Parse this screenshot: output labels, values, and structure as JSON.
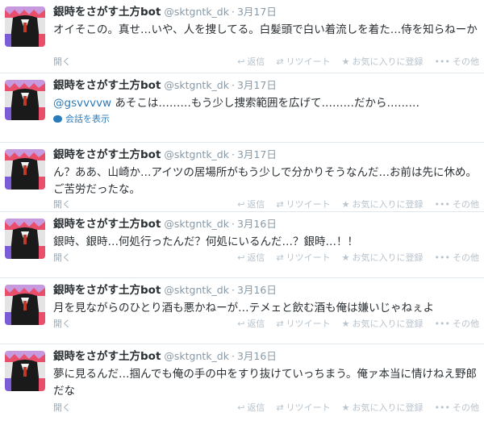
{
  "actions": {
    "reply": "返信",
    "retweet": "リツイート",
    "favorite": "お気に入りに登録",
    "more": "その他"
  },
  "tweets": [
    {
      "name": "銀時をさがす土方bot",
      "handle": "@sktgntk_dk",
      "date": "3月17日",
      "mention": "",
      "text": "オイそこの。真せ…いや、人を捜してる。白髪頭で白い着流しを着た…侍を知らねーか",
      "expand": "開く"
    },
    {
      "name": "銀時をさがす土方bot",
      "handle": "@sktgntk_dk",
      "date": "3月17日",
      "mention": "@gsvvvvw",
      "text": " あそこは………もう少し捜索範囲を広げて………だから………",
      "expand": "会話を表示"
    },
    {
      "name": "銀時をさがす土方bot",
      "handle": "@sktgntk_dk",
      "date": "3月17日",
      "mention": "",
      "text": "ん？ああ、山崎か…アイツの居場所がもう少しで分かりそうなんだ…お前は先に休め。ご苦労だったな。",
      "expand": "開く"
    },
    {
      "name": "銀時をさがす土方bot",
      "handle": "@sktgntk_dk",
      "date": "3月16日",
      "mention": "",
      "text": "銀時、銀時…何処行ったんだ？何処にいるんだ…？銀時…！！",
      "expand": "開く"
    },
    {
      "name": "銀時をさがす土方bot",
      "handle": "@sktgntk_dk",
      "date": "3月16日",
      "mention": "",
      "text": "月を見ながらのひとり酒も悪かねーが…テメェと飲む酒も俺は嫌いじゃねぇよ",
      "expand": "開く"
    },
    {
      "name": "銀時をさがす土方bot",
      "handle": "@sktgntk_dk",
      "date": "3月16日",
      "mention": "",
      "text": "夢に見るんだ…掴んでも俺の手の中をすり抜けていっちまう。俺ァ本当に情けねえ野郎だな",
      "expand": "開く"
    }
  ]
}
